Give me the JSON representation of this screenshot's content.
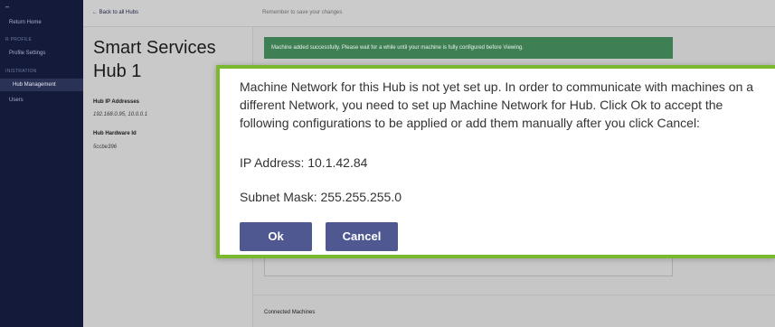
{
  "sidebar": {
    "top_marker": "••",
    "return_home": "Return Home",
    "section_profile": "R PROFILE",
    "profile_settings": "Profile Settings",
    "section_admin": "INISTRATION",
    "hub_management": "Hub Management",
    "users": "Users"
  },
  "header": {
    "back_link": "← Back to all Hubs",
    "save_reminder": "Remember to save your changes"
  },
  "hub": {
    "title": "Smart Services Hub 1",
    "ip_label": "Hub IP Addresses",
    "ip_value": "192.168.0.95, 10.0.0.1",
    "hw_label": "Hub Hardware Id",
    "hw_value": "5ccbe396"
  },
  "banner": {
    "success": "Machine added successfully. Please wait for a while until your machine is fully configured before Viewing."
  },
  "connected_machines": "Connected Machines",
  "modal": {
    "message": "Machine Network for this Hub is not yet set up. In order to communicate with machines on a different Network, you need to set up Machine Network for Hub.  Click Ok to accept the following configurations to be applied or add them manually after you click Cancel:",
    "ip_address": "IP Address: 10.1.42.84",
    "subnet_mask": "Subnet Mask: 255.255.255.0",
    "ok_label": "Ok",
    "cancel_label": "Cancel"
  },
  "colors": {
    "sidebar_bg": "#141b3a",
    "modal_border": "#7ab82e",
    "button_bg": "#4f5891",
    "success_bg": "#3f7f54"
  }
}
